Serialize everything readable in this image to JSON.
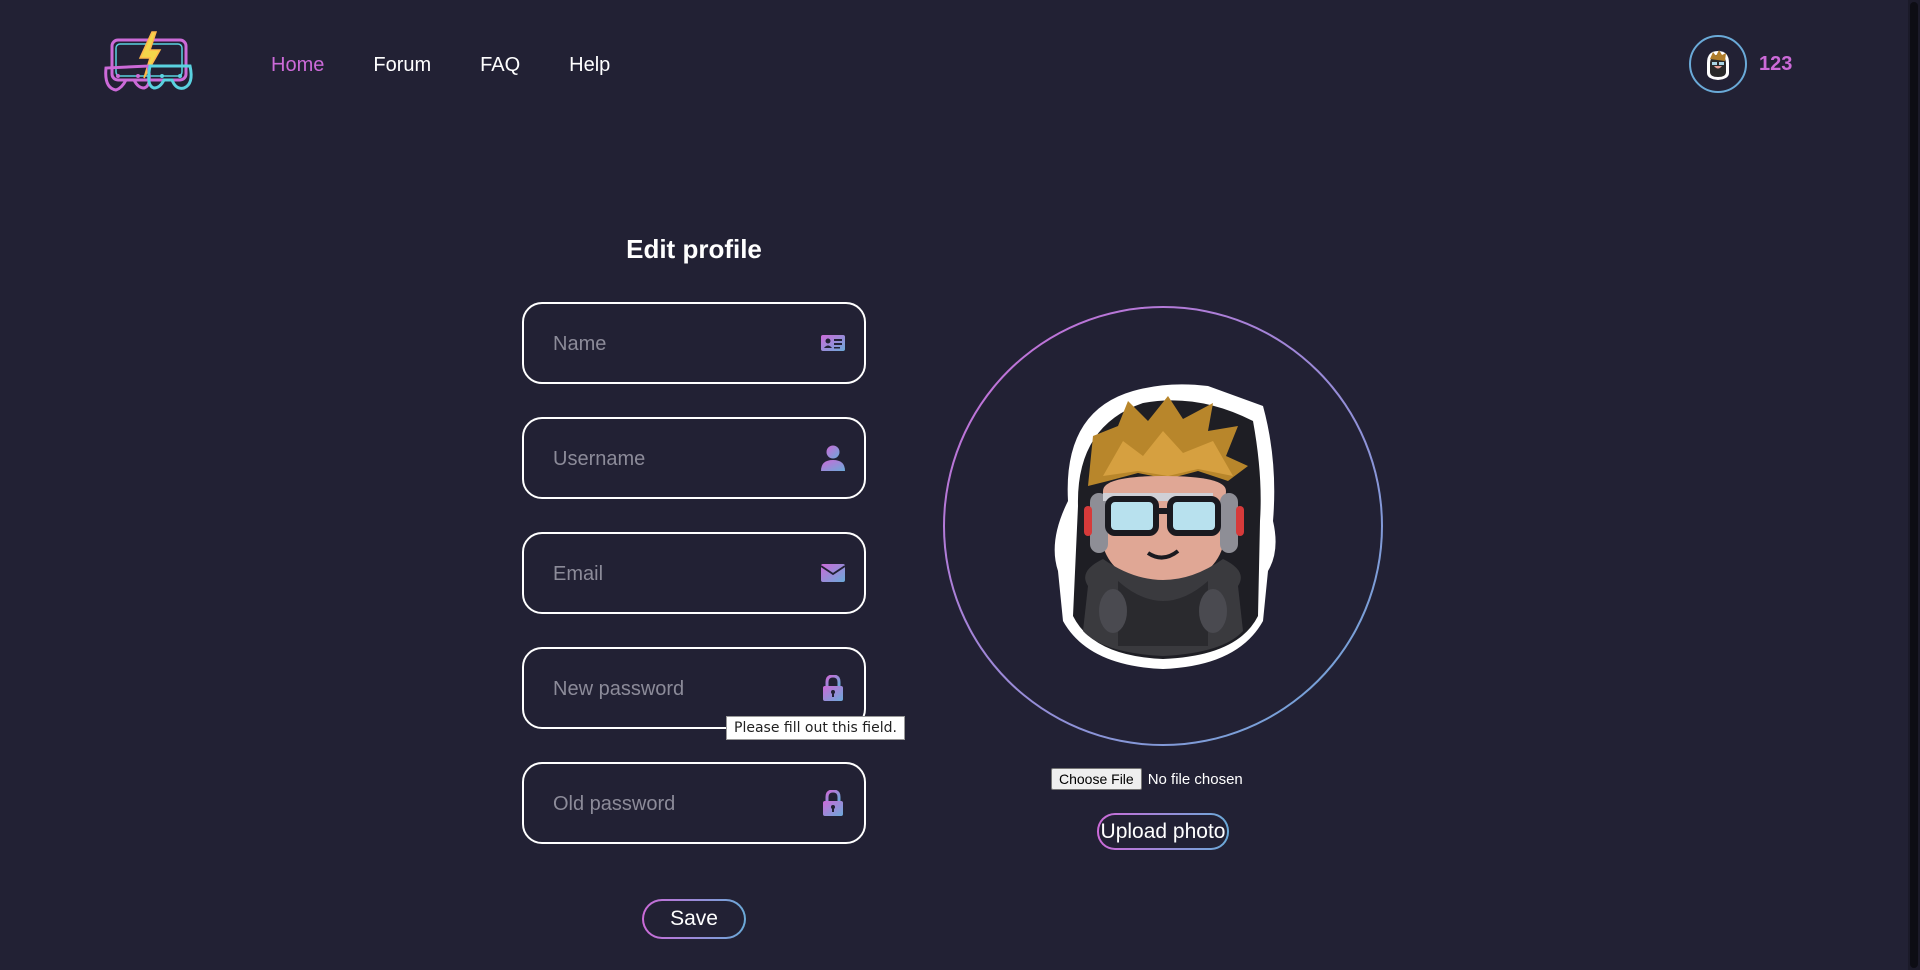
{
  "header": {
    "logo_icon": "gamepad-lightning-logo-icon",
    "nav": [
      {
        "label": "Home",
        "active": true
      },
      {
        "label": "Forum",
        "active": false
      },
      {
        "label": "FAQ",
        "active": false
      },
      {
        "label": "Help",
        "active": false
      }
    ],
    "user": {
      "avatar_icon": "gamer-avatar-icon",
      "count": "123"
    }
  },
  "form": {
    "title": "Edit profile",
    "fields": [
      {
        "placeholder": "Name",
        "value": "",
        "icon": "id-card-icon",
        "type": "text"
      },
      {
        "placeholder": "Username",
        "value": "",
        "icon": "user-icon",
        "type": "text"
      },
      {
        "placeholder": "Email",
        "value": "",
        "icon": "envelope-icon",
        "type": "email"
      },
      {
        "placeholder": "New password",
        "value": "",
        "icon": "lock-icon",
        "type": "password"
      },
      {
        "placeholder": "Old password",
        "value": "",
        "icon": "lock-icon",
        "type": "password"
      }
    ],
    "validation_tooltip": "Please fill out this field.",
    "save_label": "Save"
  },
  "photo": {
    "avatar_icon": "gamer-avatar-icon",
    "choose_file_label": "Choose File",
    "file_status": "No file chosen",
    "upload_label": "Upload photo"
  },
  "colors": {
    "background": "#222134",
    "accent_pink": "#cc6ad8",
    "accent_blue": "#6aaad8",
    "text": "#ffffff"
  }
}
